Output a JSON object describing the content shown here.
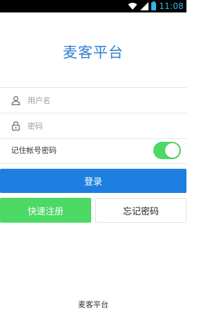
{
  "status_bar": {
    "time": "11:08",
    "icons": [
      "wifi-icon",
      "signal-icon",
      "battery-icon"
    ],
    "time_color": "#33b5e5"
  },
  "app": {
    "title": "麦客平台",
    "title_color": "#2e7fd0"
  },
  "login_form": {
    "username_placeholder": "用户名",
    "username_icon": "user-icon",
    "password_placeholder": "密码",
    "password_icon": "lock-icon",
    "remember_label": "记住帐号密码",
    "remember_enabled": true
  },
  "buttons": {
    "login_label": "登录",
    "register_label": "快速注册",
    "forgot_label": "忘记密码"
  },
  "colors": {
    "primary": "#1f7fe0",
    "success": "#4cd964"
  },
  "footer": {
    "text": "麦客平台"
  }
}
